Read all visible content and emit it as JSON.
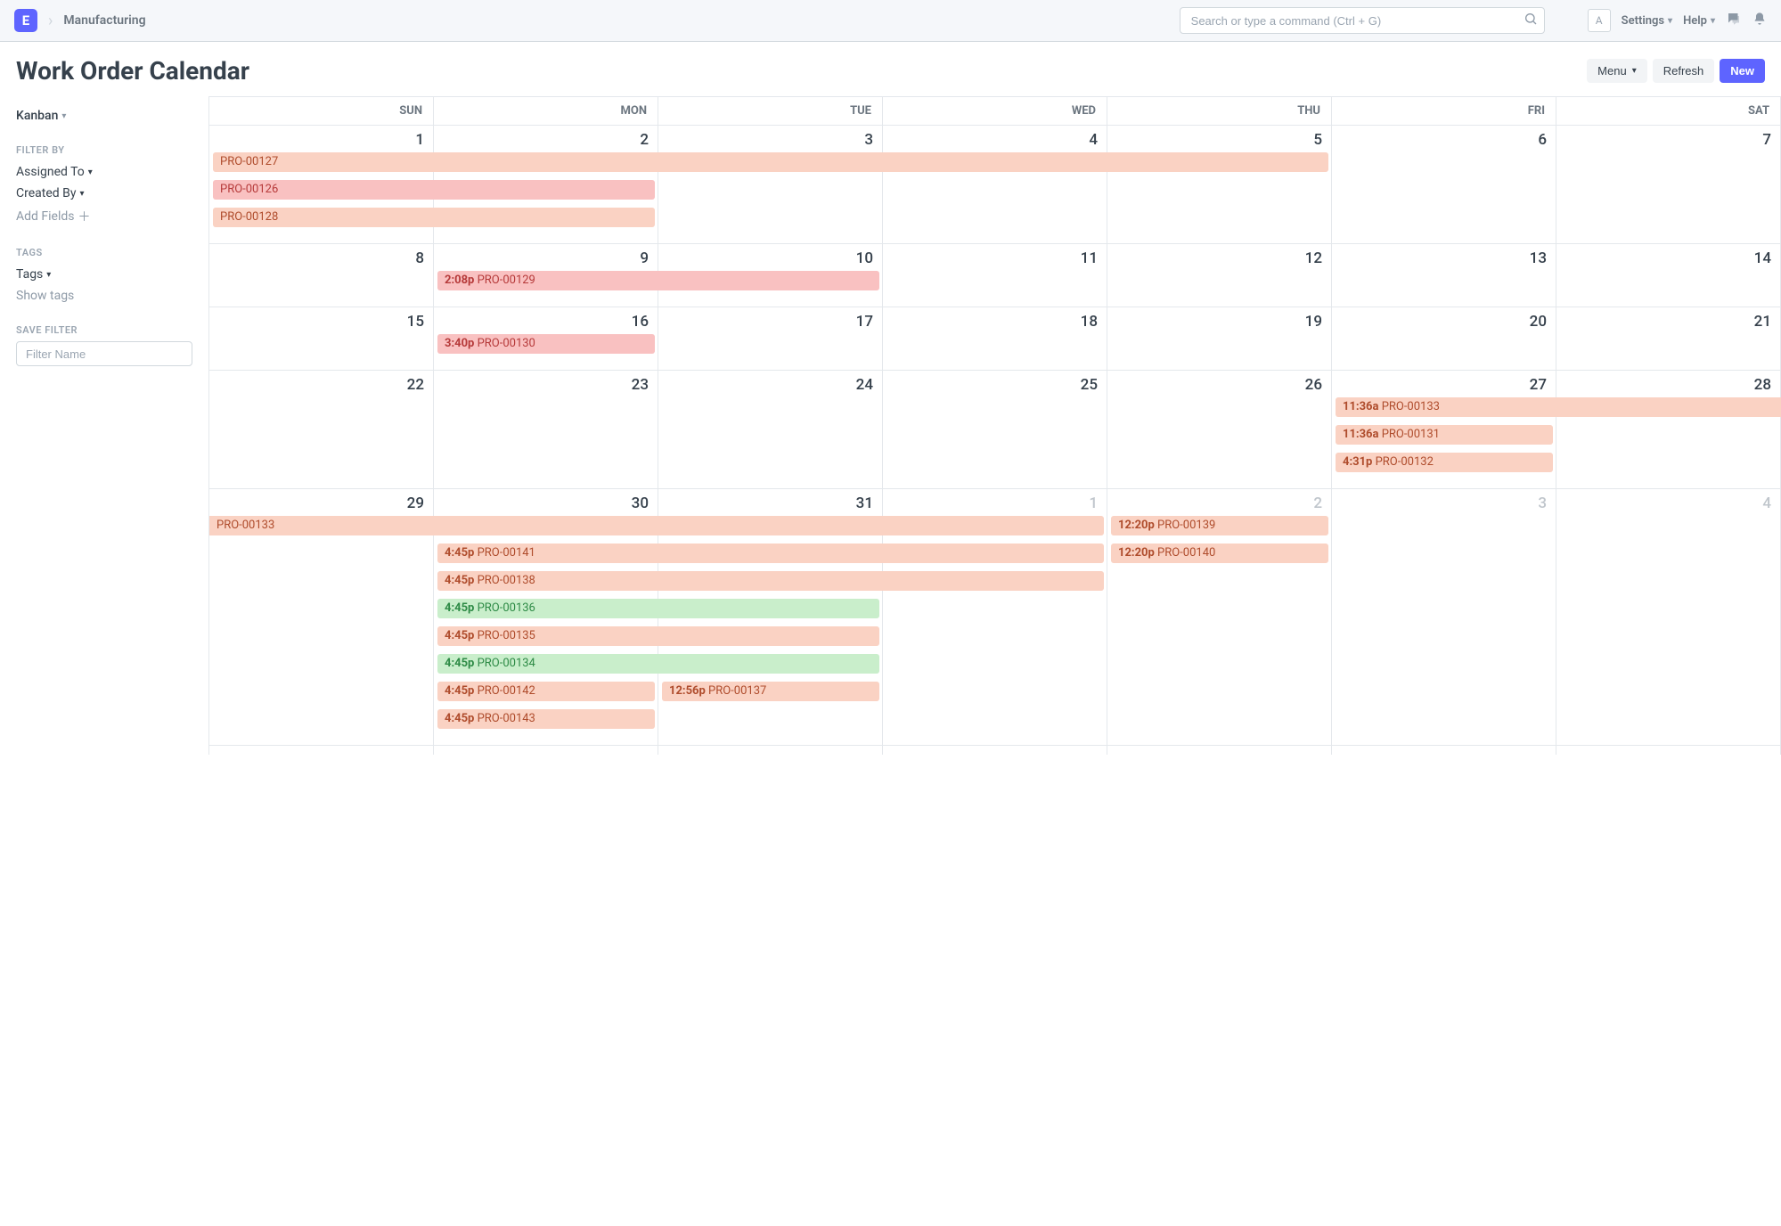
{
  "topbar": {
    "logo_letter": "E",
    "breadcrumb": "Manufacturing",
    "search_placeholder": "Search or type a command (Ctrl + G)",
    "user_initial": "A",
    "settings_label": "Settings",
    "help_label": "Help"
  },
  "page": {
    "title": "Work Order Calendar",
    "menu_btn": "Menu",
    "refresh_btn": "Refresh",
    "new_btn": "New"
  },
  "sidebar": {
    "view": "Kanban",
    "filter_by": "FILTER BY",
    "filters": [
      "Assigned To",
      "Created By"
    ],
    "add_fields": "Add Fields",
    "tags_section": "TAGS",
    "tags_label": "Tags",
    "show_tags": "Show tags",
    "save_filter": "SAVE FILTER",
    "filter_placeholder": "Filter Name"
  },
  "calendar": {
    "day_headers": [
      "SUN",
      "MON",
      "TUE",
      "WED",
      "THU",
      "FRI",
      "SAT"
    ],
    "weeks": [
      {
        "days": [
          "1",
          "2",
          "3",
          "4",
          "5",
          "6",
          "7"
        ],
        "out_mask": [
          0,
          0,
          0,
          0,
          0,
          0,
          0
        ],
        "events": [
          {
            "label": "PRO-00127",
            "start": 0,
            "span": 5,
            "color": "default",
            "row": 0,
            "rounded": "both"
          },
          {
            "label": "PRO-00126",
            "start": 0,
            "span": 2,
            "color": "red",
            "row": 1,
            "rounded": "both"
          },
          {
            "label": "PRO-00128",
            "start": 0,
            "span": 2,
            "color": "default",
            "row": 2,
            "rounded": "both"
          }
        ]
      },
      {
        "days": [
          "8",
          "9",
          "10",
          "11",
          "12",
          "13",
          "14"
        ],
        "out_mask": [
          0,
          0,
          0,
          0,
          0,
          0,
          0
        ],
        "events": [
          {
            "time": "2:08p",
            "label": "PRO-00129",
            "start": 1,
            "span": 2,
            "color": "red",
            "row": 0,
            "rounded": "both"
          }
        ]
      },
      {
        "days": [
          "15",
          "16",
          "17",
          "18",
          "19",
          "20",
          "21"
        ],
        "out_mask": [
          0,
          0,
          0,
          0,
          0,
          0,
          0
        ],
        "events": [
          {
            "time": "3:40p",
            "label": "PRO-00130",
            "start": 1,
            "span": 1,
            "color": "red",
            "row": 0,
            "rounded": "both"
          }
        ]
      },
      {
        "days": [
          "22",
          "23",
          "24",
          "25",
          "26",
          "27",
          "28"
        ],
        "out_mask": [
          0,
          0,
          0,
          0,
          0,
          0,
          0
        ],
        "events": [
          {
            "time": "11:36a",
            "label": "PRO-00133",
            "start": 5,
            "span": 2,
            "color": "default",
            "row": 0,
            "rounded": "left"
          },
          {
            "time": "11:36a",
            "label": "PRO-00131",
            "start": 5,
            "span": 1,
            "color": "default",
            "row": 1,
            "rounded": "both"
          },
          {
            "time": "4:31p",
            "label": "PRO-00132",
            "start": 5,
            "span": 1,
            "color": "default",
            "row": 2,
            "rounded": "both"
          }
        ]
      },
      {
        "days": [
          "29",
          "30",
          "31",
          "1",
          "2",
          "3",
          "4"
        ],
        "out_mask": [
          0,
          0,
          0,
          1,
          1,
          1,
          1
        ],
        "events": [
          {
            "label": "PRO-00133",
            "start": 0,
            "span": 4,
            "color": "default",
            "row": 0,
            "rounded": "right"
          },
          {
            "time": "12:20p",
            "label": "PRO-00139",
            "start": 4,
            "span": 1,
            "color": "default",
            "row": 0,
            "rounded": "both"
          },
          {
            "time": "4:45p",
            "label": "PRO-00141",
            "start": 1,
            "span": 3,
            "color": "default",
            "row": 1,
            "rounded": "both"
          },
          {
            "time": "12:20p",
            "label": "PRO-00140",
            "start": 4,
            "span": 1,
            "color": "default",
            "row": 1,
            "rounded": "both"
          },
          {
            "time": "4:45p",
            "label": "PRO-00138",
            "start": 1,
            "span": 3,
            "color": "default",
            "row": 2,
            "rounded": "both"
          },
          {
            "time": "4:45p",
            "label": "PRO-00136",
            "start": 1,
            "span": 2,
            "color": "green",
            "row": 3,
            "rounded": "both"
          },
          {
            "time": "4:45p",
            "label": "PRO-00135",
            "start": 1,
            "span": 2,
            "color": "default",
            "row": 4,
            "rounded": "both"
          },
          {
            "time": "4:45p",
            "label": "PRO-00134",
            "start": 1,
            "span": 2,
            "color": "green",
            "row": 5,
            "rounded": "both"
          },
          {
            "time": "4:45p",
            "label": "PRO-00142",
            "start": 1,
            "span": 1,
            "color": "default",
            "row": 6,
            "rounded": "both"
          },
          {
            "time": "12:56p",
            "label": "PRO-00137",
            "start": 2,
            "span": 1,
            "color": "default",
            "row": 6,
            "rounded": "both"
          },
          {
            "time": "4:45p",
            "label": "PRO-00143",
            "start": 1,
            "span": 1,
            "color": "default",
            "row": 7,
            "rounded": "both"
          }
        ]
      }
    ]
  }
}
